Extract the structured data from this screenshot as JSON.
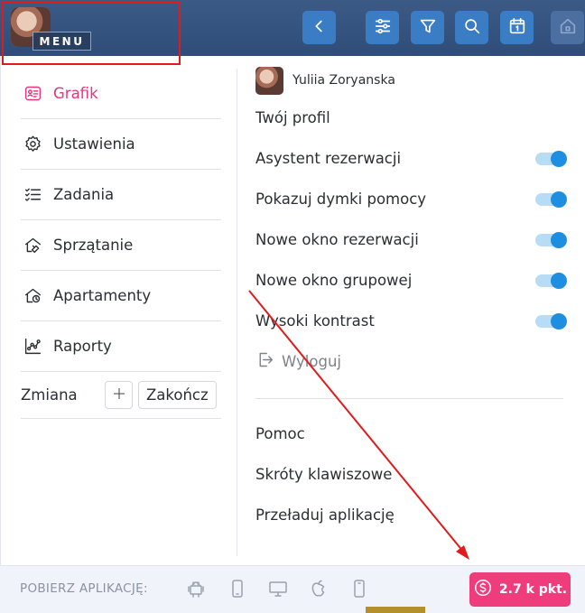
{
  "topbar": {
    "menu_label": "MENU",
    "buttons": [
      "back-icon",
      "sliders-icon",
      "filter-icon",
      "search-icon",
      "calendar-icon",
      "home-icon"
    ],
    "calendar_day": "1"
  },
  "nav": {
    "items": [
      {
        "label": "Grafik",
        "icon": "schedule-card-icon",
        "active": true
      },
      {
        "label": "Ustawienia",
        "icon": "gear-icon",
        "active": false
      },
      {
        "label": "Zadania",
        "icon": "checklist-icon",
        "active": false
      },
      {
        "label": "Sprzątanie",
        "icon": "house-cleaning-icon",
        "active": false
      },
      {
        "label": "Apartamenty",
        "icon": "apartments-icon",
        "active": false
      },
      {
        "label": "Raporty",
        "icon": "chart-icon",
        "active": false
      }
    ],
    "shift_label": "Zmiana",
    "end_label": "Zakończ"
  },
  "user": {
    "name": "Yuliia Zoryanska",
    "profile_label": "Twój profil"
  },
  "settings": {
    "toggles": [
      {
        "label": "Asystent rezerwacji",
        "on": true
      },
      {
        "label": "Pokazuj dymki pomocy",
        "on": true
      },
      {
        "label": "Nowe okno rezerwacji",
        "on": true
      },
      {
        "label": "Nowe okno grupowej",
        "on": true
      },
      {
        "label": "Wysoki kontrast",
        "on": true
      }
    ],
    "logout_label": "Wyloguj"
  },
  "help": {
    "items": [
      "Pomoc",
      "Skróty klawiszowe",
      "Przeładuj aplikację"
    ]
  },
  "bottom": {
    "download_label": "POBIERZ APLIKACJĘ:",
    "platform_icons": [
      "android-icon",
      "phone-icon",
      "desktop-icon",
      "apple-icon",
      "tablet-icon"
    ],
    "points_label": "2.7 k pkt."
  },
  "colors": {
    "accent_pink": "#e5357f",
    "toggle_blue": "#1e8fe0",
    "topbar": "#2f4d78",
    "annotation_red": "#e01b1b"
  }
}
